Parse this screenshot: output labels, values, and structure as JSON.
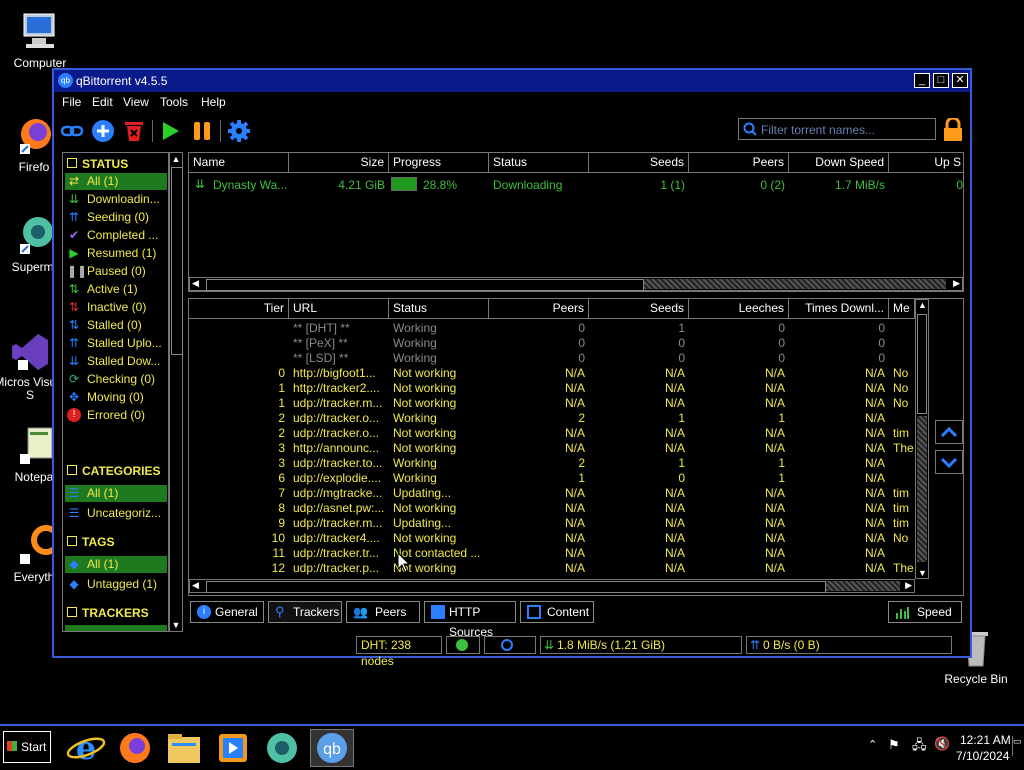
{
  "desktop": {
    "icons": [
      {
        "label": "Computer"
      },
      {
        "label": "Firefo"
      },
      {
        "label": "Supermi"
      },
      {
        "label": "Micros Visual S"
      },
      {
        "label": "Notepa"
      },
      {
        "label": "Everyth"
      },
      {
        "label": "Recycle Bin"
      }
    ]
  },
  "window": {
    "title": "qBittorrent v4.5.5",
    "menu": [
      "File",
      "Edit",
      "View",
      "Tools",
      "Help"
    ],
    "search_placeholder": "Filter torrent names..."
  },
  "sidebar": {
    "status_header": "STATUS",
    "status_items": [
      {
        "label": "All (1)",
        "icon": "filter-all-icon",
        "color": "#f2e94e"
      },
      {
        "label": "Downloadin...",
        "icon": "download-icon"
      },
      {
        "label": "Seeding (0)",
        "icon": "upload-icon"
      },
      {
        "label": "Completed ...",
        "icon": "check-icon"
      },
      {
        "label": "Resumed (1)",
        "icon": "play-icon"
      },
      {
        "label": "Paused (0)",
        "icon": "pause-icon"
      },
      {
        "label": "Active (1)",
        "icon": "active-arrows-icon"
      },
      {
        "label": "Inactive (0)",
        "icon": "inactive-arrows-icon"
      },
      {
        "label": "Stalled (0)",
        "icon": "stalled-icon"
      },
      {
        "label": "Stalled Uplo...",
        "icon": "stalled-upload-icon"
      },
      {
        "label": "Stalled Dow...",
        "icon": "stalled-download-icon"
      },
      {
        "label": "Checking (0)",
        "icon": "checking-icon"
      },
      {
        "label": "Moving (0)",
        "icon": "moving-icon"
      },
      {
        "label": "Errored (0)",
        "icon": "error-icon"
      }
    ],
    "categories_header": "CATEGORIES",
    "category_items": [
      {
        "label": "All (1)"
      },
      {
        "label": "Uncategoriz..."
      }
    ],
    "tags_header": "TAGS",
    "tag_items": [
      {
        "label": "All (1)"
      },
      {
        "label": "Untagged (1)"
      }
    ],
    "trackers_header": "TRACKERS"
  },
  "torrents": {
    "columns": [
      "Name",
      "Size",
      "Progress",
      "Status",
      "Seeds",
      "Peers",
      "Down Speed",
      "Up S"
    ],
    "rows": [
      {
        "name": "Dynasty Wa...",
        "size": "4.21 GiB",
        "progress_text": "28.8%",
        "progress": 0.288,
        "status": "Downloading",
        "seeds": "1 (1)",
        "peers": "0 (2)",
        "down_speed": "1.7 MiB/s",
        "up_speed": "0"
      }
    ]
  },
  "trackers": {
    "columns": [
      "Tier",
      "URL",
      "Status",
      "Peers",
      "Seeds",
      "Leeches",
      "Times Downl...",
      "Me"
    ],
    "rows": [
      {
        "tier": "",
        "url": "** [DHT] **",
        "status": "Working",
        "peers": "0",
        "seeds": "1",
        "leeches": "0",
        "times": "0",
        "msg": "",
        "dim": true
      },
      {
        "tier": "",
        "url": "** [PeX] **",
        "status": "Working",
        "peers": "0",
        "seeds": "0",
        "leeches": "0",
        "times": "0",
        "msg": "",
        "dim": true
      },
      {
        "tier": "",
        "url": "** [LSD] **",
        "status": "Working",
        "peers": "0",
        "seeds": "0",
        "leeches": "0",
        "times": "0",
        "msg": "",
        "dim": true
      },
      {
        "tier": "0",
        "url": "http://bigfoot1...",
        "status": "Not working",
        "peers": "N/A",
        "seeds": "N/A",
        "leeches": "N/A",
        "times": "N/A",
        "msg": "No"
      },
      {
        "tier": "1",
        "url": "http://tracker2....",
        "status": "Not working",
        "peers": "N/A",
        "seeds": "N/A",
        "leeches": "N/A",
        "times": "N/A",
        "msg": "No"
      },
      {
        "tier": "1",
        "url": "udp://tracker.m...",
        "status": "Not working",
        "peers": "N/A",
        "seeds": "N/A",
        "leeches": "N/A",
        "times": "N/A",
        "msg": "No"
      },
      {
        "tier": "2",
        "url": "udp://tracker.o...",
        "status": "Working",
        "peers": "2",
        "seeds": "1",
        "leeches": "1",
        "times": "N/A",
        "msg": ""
      },
      {
        "tier": "2",
        "url": "udp://tracker.o...",
        "status": "Not working",
        "peers": "N/A",
        "seeds": "N/A",
        "leeches": "N/A",
        "times": "N/A",
        "msg": "tim"
      },
      {
        "tier": "3",
        "url": "http://announc...",
        "status": "Not working",
        "peers": "N/A",
        "seeds": "N/A",
        "leeches": "N/A",
        "times": "N/A",
        "msg": "The"
      },
      {
        "tier": "3",
        "url": "udp://tracker.to...",
        "status": "Working",
        "peers": "2",
        "seeds": "1",
        "leeches": "1",
        "times": "N/A",
        "msg": ""
      },
      {
        "tier": "6",
        "url": "udp://explodie....",
        "status": "Working",
        "peers": "1",
        "seeds": "0",
        "leeches": "1",
        "times": "N/A",
        "msg": ""
      },
      {
        "tier": "7",
        "url": "udp://mgtracke...",
        "status": "Updating...",
        "peers": "N/A",
        "seeds": "N/A",
        "leeches": "N/A",
        "times": "N/A",
        "msg": "tim"
      },
      {
        "tier": "8",
        "url": "udp://asnet.pw:...",
        "status": "Not working",
        "peers": "N/A",
        "seeds": "N/A",
        "leeches": "N/A",
        "times": "N/A",
        "msg": "tim"
      },
      {
        "tier": "9",
        "url": "udp://tracker.m...",
        "status": "Updating...",
        "peers": "N/A",
        "seeds": "N/A",
        "leeches": "N/A",
        "times": "N/A",
        "msg": "tim"
      },
      {
        "tier": "10",
        "url": "udp://tracker4....",
        "status": "Not working",
        "peers": "N/A",
        "seeds": "N/A",
        "leeches": "N/A",
        "times": "N/A",
        "msg": "No"
      },
      {
        "tier": "11",
        "url": "udp://tracker.tr...",
        "status": "Not contacted ...",
        "peers": "N/A",
        "seeds": "N/A",
        "leeches": "N/A",
        "times": "N/A",
        "msg": ""
      },
      {
        "tier": "12",
        "url": "udp://tracker.p...",
        "status": "Not working",
        "peers": "N/A",
        "seeds": "N/A",
        "leeches": "N/A",
        "times": "N/A",
        "msg": "The"
      }
    ]
  },
  "bottom_tabs": {
    "general": "General",
    "trackers": "Trackers",
    "peers": "Peers",
    "http_sources": "HTTP Sources",
    "content": "Content",
    "speed": "Speed"
  },
  "statusbar": {
    "dht": "DHT: 238 nodes",
    "download": "1.8 MiB/s (1.21 GiB)",
    "upload": "0 B/s (0 B)"
  },
  "taskbar": {
    "start_label": "Start",
    "clock_time": "12:21 AM",
    "clock_date": "7/10/2024"
  },
  "colors": {
    "text_yellow": "#f2e94e",
    "downloading_green": "#3fbf3f",
    "selection_green": "#1f7a1f",
    "title_blue": "#0a1a8a",
    "accent_blue": "#2a7fff"
  }
}
